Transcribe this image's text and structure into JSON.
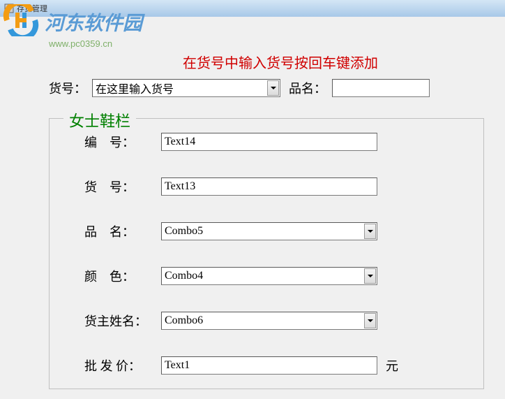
{
  "window": {
    "title": "存货管理"
  },
  "watermark": {
    "text": "河东软件园",
    "url": "www.pc0359.cn"
  },
  "instruction": "在货号中输入货号按回车键添加",
  "topbar": {
    "huohao_label": "货号：",
    "huohao_value": "在这里输入货号",
    "pinming_label": "品名：",
    "pinming_value": ""
  },
  "fieldset": {
    "legend": "女士鞋栏",
    "rows": [
      {
        "label": "编　号：",
        "value": "Text14",
        "type": "text"
      },
      {
        "label": "货　号：",
        "value": "Text13",
        "type": "text"
      },
      {
        "label": "品　名：",
        "value": "Combo5",
        "type": "combo"
      },
      {
        "label": "颜　色：",
        "value": "Combo4",
        "type": "combo"
      },
      {
        "label": "货主姓名：",
        "value": "Combo6",
        "type": "combo"
      },
      {
        "label": "批 发 价：",
        "value": "Text1",
        "type": "text",
        "unit": "元"
      }
    ]
  }
}
